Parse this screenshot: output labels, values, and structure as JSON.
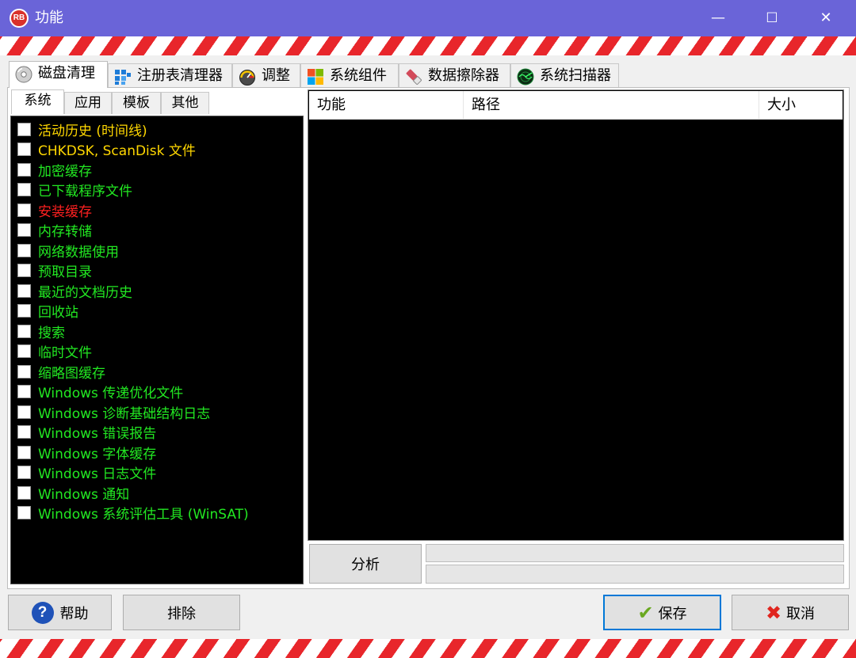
{
  "window": {
    "logo": "RB",
    "title": "功能",
    "controls": {
      "minimize": "—",
      "maximize": "☐",
      "close": "✕"
    }
  },
  "tabs": [
    {
      "label": "磁盘清理",
      "icon": "disk-icon"
    },
    {
      "label": "注册表清理器",
      "icon": "registry-icon"
    },
    {
      "label": "调整",
      "icon": "gauge-icon"
    },
    {
      "label": "系统组件",
      "icon": "windows-logo-icon"
    },
    {
      "label": "数据擦除器",
      "icon": "eraser-icon"
    },
    {
      "label": "系统扫描器",
      "icon": "radar-icon"
    }
  ],
  "subtabs": [
    "系统",
    "应用",
    "模板",
    "其他"
  ],
  "checklist": [
    {
      "label": "活动历史 (时间线)",
      "color": "#ffd700"
    },
    {
      "label": "CHKDSK, ScanDisk 文件",
      "color": "#ffd700"
    },
    {
      "label": "加密缓存",
      "color": "#22e822"
    },
    {
      "label": "已下载程序文件",
      "color": "#22e822"
    },
    {
      "label": "安装缓存",
      "color": "#ff2020"
    },
    {
      "label": "内存转储",
      "color": "#22e822"
    },
    {
      "label": "网络数据使用",
      "color": "#22e822"
    },
    {
      "label": "预取目录",
      "color": "#22e822"
    },
    {
      "label": "最近的文档历史",
      "color": "#22e822"
    },
    {
      "label": "回收站",
      "color": "#22e822"
    },
    {
      "label": "搜索",
      "color": "#22e822"
    },
    {
      "label": "临时文件",
      "color": "#22e822"
    },
    {
      "label": "缩略图缓存",
      "color": "#22e822"
    },
    {
      "label": "Windows 传递优化文件",
      "color": "#22e822"
    },
    {
      "label": "Windows 诊断基础结构日志",
      "color": "#22e822"
    },
    {
      "label": "Windows 错误报告",
      "color": "#22e822"
    },
    {
      "label": "Windows 字体缓存",
      "color": "#22e822"
    },
    {
      "label": "Windows 日志文件",
      "color": "#22e822"
    },
    {
      "label": "Windows 通知",
      "color": "#22e822"
    },
    {
      "label": "Windows 系统评估工具 (WinSAT)",
      "color": "#22e822"
    }
  ],
  "results": {
    "columns": [
      "功能",
      "路径",
      "大小"
    ]
  },
  "analyze_label": "分析",
  "footer": {
    "help_label": "帮助",
    "help_icon": "?",
    "exclude_label": "排除",
    "save_label": "保存",
    "save_icon": "✔",
    "cancel_label": "取消",
    "cancel_icon": "✖"
  },
  "colors": {
    "titlebar": "#6a64d8",
    "stripe_red": "#e8262b",
    "list_bg": "#000000",
    "focus_border": "#0078d7"
  }
}
